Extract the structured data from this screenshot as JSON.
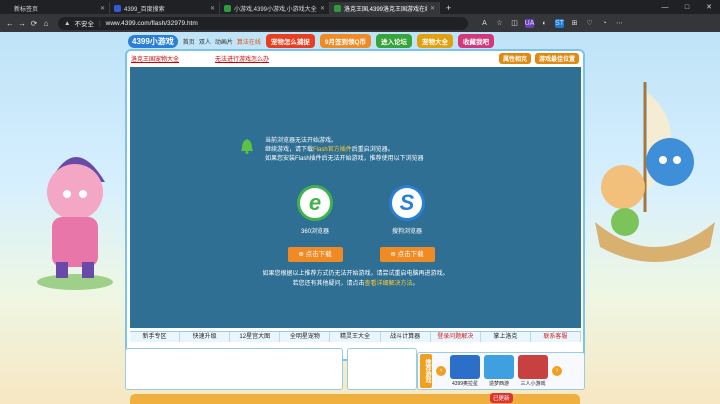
{
  "tabs": [
    {
      "title": "新标签页",
      "color": "#5f6368"
    },
    {
      "title": "4399_百度搜索",
      "color": "#2f5bd8"
    },
    {
      "title": "小游戏,4399小游戏,小游戏大全,双人",
      "color": "#2e9a3e"
    },
    {
      "title": "洛克王国,4399洛克王国游戏在线玩",
      "color": "#2e9a3e"
    }
  ],
  "newtab": "+",
  "window_controls": {
    "min": "—",
    "max": "□",
    "close": "✕"
  },
  "address": {
    "security": "不安全",
    "url": "www.4399.com/flash/32979.htm"
  },
  "extensions": [
    "A",
    "☆",
    "◫",
    "UA",
    "◐",
    "ST",
    "⊞",
    "♡",
    "◔",
    "⋯"
  ],
  "site": {
    "logo": "4399小游戏",
    "nav": [
      "首页",
      "双人",
      "动画片",
      "算法在线"
    ],
    "buttons": [
      {
        "label": "宠物怎么捕捉",
        "color": "#e83d1f"
      },
      {
        "label": "9月签到领Q币",
        "color": "#f08a24"
      },
      {
        "label": "进入论坛",
        "color": "#38a339"
      },
      {
        "label": "宠物大全",
        "color": "#e0a010"
      },
      {
        "label": "收藏我吧",
        "color": "#d03a7a"
      }
    ]
  },
  "game": {
    "info_left": "洛克王国宠物大全",
    "info_middle": "无法进行游戏怎么办",
    "info_buttons": [
      {
        "label": "属性相克",
        "color": "#e08a10"
      },
      {
        "label": "游戏最佳位置",
        "color": "#e08a10"
      }
    ],
    "message": {
      "line1": "当前浏览器无法开始游戏。",
      "line2_a": "继续游戏，请下载",
      "line2_hl": "Flash官方插件",
      "line2_b": "后重启浏览器。",
      "line3": "如果您安装Flash插件后无法开始游戏，推荐使用以下浏览器"
    },
    "browsers": [
      {
        "name": "360浏览器",
        "button": "点击下载",
        "color": "#3fb34f",
        "glyph": "e"
      },
      {
        "name": "搜狗浏览器",
        "button": "点击下载",
        "color": "#2a7fd4",
        "glyph": "S"
      }
    ],
    "footer_msg": {
      "line1": "如果您根据以上推荐方式仍无法开始游戏，请尝试重启电脑再进游戏。",
      "line2_a": "若您还有其他疑问，请点击",
      "line2_hl": "查看详细解决方法",
      "line2_b": "。"
    },
    "bottom_tabs": [
      {
        "label": "新手专区",
        "red": false
      },
      {
        "label": "快速升级",
        "red": false
      },
      {
        "label": "12星宫大图",
        "red": false
      },
      {
        "label": "全明星宠物",
        "red": false
      },
      {
        "label": "精灵王大全",
        "red": false
      },
      {
        "label": "战斗计算器",
        "red": false
      },
      {
        "label": "登录问题解决",
        "red": true
      },
      {
        "label": "掌上洛克",
        "red": false
      },
      {
        "label": "联系客服",
        "red": true
      }
    ]
  },
  "recommend": {
    "label": "推荐游戏",
    "games": [
      {
        "name": "4399奥拉星",
        "color": "#2b6fc8"
      },
      {
        "name": "造梦西游",
        "color": "#3ea0e0"
      },
      {
        "name": "三人小游戏",
        "color": "#c84040"
      }
    ]
  },
  "update_badge": "已更新"
}
